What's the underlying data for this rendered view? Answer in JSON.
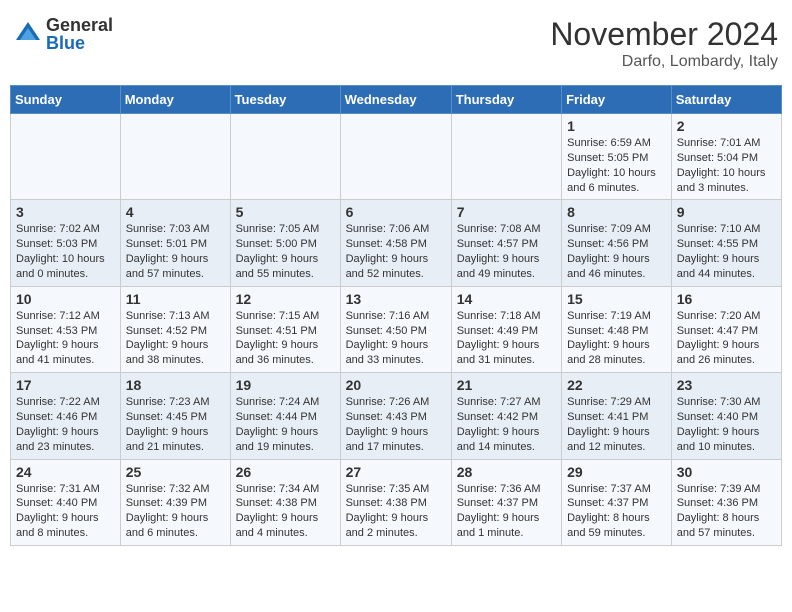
{
  "header": {
    "logo_general": "General",
    "logo_blue": "Blue",
    "month_title": "November 2024",
    "location": "Darfo, Lombardy, Italy"
  },
  "weekdays": [
    "Sunday",
    "Monday",
    "Tuesday",
    "Wednesday",
    "Thursday",
    "Friday",
    "Saturday"
  ],
  "weeks": [
    [
      {
        "day": "",
        "info": ""
      },
      {
        "day": "",
        "info": ""
      },
      {
        "day": "",
        "info": ""
      },
      {
        "day": "",
        "info": ""
      },
      {
        "day": "",
        "info": ""
      },
      {
        "day": "1",
        "info": "Sunrise: 6:59 AM\nSunset: 5:05 PM\nDaylight: 10 hours\nand 6 minutes."
      },
      {
        "day": "2",
        "info": "Sunrise: 7:01 AM\nSunset: 5:04 PM\nDaylight: 10 hours\nand 3 minutes."
      }
    ],
    [
      {
        "day": "3",
        "info": "Sunrise: 7:02 AM\nSunset: 5:03 PM\nDaylight: 10 hours\nand 0 minutes."
      },
      {
        "day": "4",
        "info": "Sunrise: 7:03 AM\nSunset: 5:01 PM\nDaylight: 9 hours\nand 57 minutes."
      },
      {
        "day": "5",
        "info": "Sunrise: 7:05 AM\nSunset: 5:00 PM\nDaylight: 9 hours\nand 55 minutes."
      },
      {
        "day": "6",
        "info": "Sunrise: 7:06 AM\nSunset: 4:58 PM\nDaylight: 9 hours\nand 52 minutes."
      },
      {
        "day": "7",
        "info": "Sunrise: 7:08 AM\nSunset: 4:57 PM\nDaylight: 9 hours\nand 49 minutes."
      },
      {
        "day": "8",
        "info": "Sunrise: 7:09 AM\nSunset: 4:56 PM\nDaylight: 9 hours\nand 46 minutes."
      },
      {
        "day": "9",
        "info": "Sunrise: 7:10 AM\nSunset: 4:55 PM\nDaylight: 9 hours\nand 44 minutes."
      }
    ],
    [
      {
        "day": "10",
        "info": "Sunrise: 7:12 AM\nSunset: 4:53 PM\nDaylight: 9 hours\nand 41 minutes."
      },
      {
        "day": "11",
        "info": "Sunrise: 7:13 AM\nSunset: 4:52 PM\nDaylight: 9 hours\nand 38 minutes."
      },
      {
        "day": "12",
        "info": "Sunrise: 7:15 AM\nSunset: 4:51 PM\nDaylight: 9 hours\nand 36 minutes."
      },
      {
        "day": "13",
        "info": "Sunrise: 7:16 AM\nSunset: 4:50 PM\nDaylight: 9 hours\nand 33 minutes."
      },
      {
        "day": "14",
        "info": "Sunrise: 7:18 AM\nSunset: 4:49 PM\nDaylight: 9 hours\nand 31 minutes."
      },
      {
        "day": "15",
        "info": "Sunrise: 7:19 AM\nSunset: 4:48 PM\nDaylight: 9 hours\nand 28 minutes."
      },
      {
        "day": "16",
        "info": "Sunrise: 7:20 AM\nSunset: 4:47 PM\nDaylight: 9 hours\nand 26 minutes."
      }
    ],
    [
      {
        "day": "17",
        "info": "Sunrise: 7:22 AM\nSunset: 4:46 PM\nDaylight: 9 hours\nand 23 minutes."
      },
      {
        "day": "18",
        "info": "Sunrise: 7:23 AM\nSunset: 4:45 PM\nDaylight: 9 hours\nand 21 minutes."
      },
      {
        "day": "19",
        "info": "Sunrise: 7:24 AM\nSunset: 4:44 PM\nDaylight: 9 hours\nand 19 minutes."
      },
      {
        "day": "20",
        "info": "Sunrise: 7:26 AM\nSunset: 4:43 PM\nDaylight: 9 hours\nand 17 minutes."
      },
      {
        "day": "21",
        "info": "Sunrise: 7:27 AM\nSunset: 4:42 PM\nDaylight: 9 hours\nand 14 minutes."
      },
      {
        "day": "22",
        "info": "Sunrise: 7:29 AM\nSunset: 4:41 PM\nDaylight: 9 hours\nand 12 minutes."
      },
      {
        "day": "23",
        "info": "Sunrise: 7:30 AM\nSunset: 4:40 PM\nDaylight: 9 hours\nand 10 minutes."
      }
    ],
    [
      {
        "day": "24",
        "info": "Sunrise: 7:31 AM\nSunset: 4:40 PM\nDaylight: 9 hours\nand 8 minutes."
      },
      {
        "day": "25",
        "info": "Sunrise: 7:32 AM\nSunset: 4:39 PM\nDaylight: 9 hours\nand 6 minutes."
      },
      {
        "day": "26",
        "info": "Sunrise: 7:34 AM\nSunset: 4:38 PM\nDaylight: 9 hours\nand 4 minutes."
      },
      {
        "day": "27",
        "info": "Sunrise: 7:35 AM\nSunset: 4:38 PM\nDaylight: 9 hours\nand 2 minutes."
      },
      {
        "day": "28",
        "info": "Sunrise: 7:36 AM\nSunset: 4:37 PM\nDaylight: 9 hours\nand 1 minute."
      },
      {
        "day": "29",
        "info": "Sunrise: 7:37 AM\nSunset: 4:37 PM\nDaylight: 8 hours\nand 59 minutes."
      },
      {
        "day": "30",
        "info": "Sunrise: 7:39 AM\nSunset: 4:36 PM\nDaylight: 8 hours\nand 57 minutes."
      }
    ]
  ]
}
